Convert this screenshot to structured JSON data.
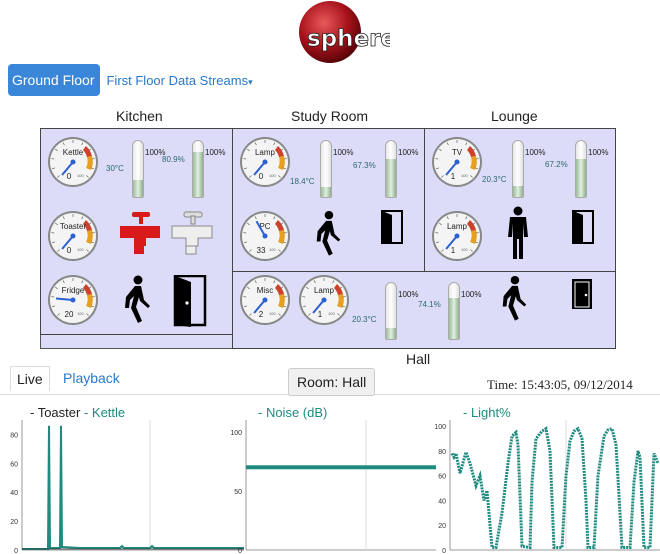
{
  "brand": {
    "logo_text": "sphere"
  },
  "nav": {
    "ground_floor": "Ground Floor",
    "first_floor": "First Floor Data Streams",
    "caret": "▾"
  },
  "rooms": {
    "kitchen": "Kitchen",
    "study_room": "Study Room",
    "lounge": "Lounge",
    "hall": "Hall"
  },
  "kitchen": {
    "gauges": [
      {
        "label": "Kettle",
        "value": "0"
      },
      {
        "label": "Toaster",
        "value": "0"
      },
      {
        "label": "Fridge",
        "value": "20"
      }
    ],
    "temp": "30°C",
    "humidity": "80.9%",
    "therm1_max": "100%",
    "therm2_max": "100%",
    "temp_level": 0.3,
    "humidity_level": 0.809
  },
  "study": {
    "gauges": [
      {
        "label": "Lamp",
        "value": "0"
      },
      {
        "label": "PC",
        "value": "33"
      }
    ],
    "temp": "18.4°C",
    "humidity": "67.3%",
    "therm1_max": "100%",
    "therm2_max": "100%",
    "temp_level": 0.184,
    "humidity_level": 0.673
  },
  "lounge": {
    "gauges": [
      {
        "label": "TV",
        "value": "1"
      },
      {
        "label": "Lamp",
        "value": "1"
      }
    ],
    "temp": "20.3°C",
    "humidity": "67.2%",
    "therm1_max": "100%",
    "therm2_max": "100%",
    "temp_level": 0.203,
    "humidity_level": 0.672
  },
  "hall": {
    "gauges": [
      {
        "label": "Misc",
        "value": "2"
      },
      {
        "label": "Lamp",
        "value": "1"
      }
    ],
    "temp": "20.3°C",
    "humidity": "74.1%",
    "therm1_max": "100%",
    "therm2_max": "100%",
    "temp_level": 0.203,
    "humidity_level": 0.741
  },
  "gauge_scale_max": "100",
  "tabs": {
    "live": "Live",
    "playback": "Playback"
  },
  "room_select": "Room: Hall",
  "time": "Time: 15:43:05, 09/12/2014",
  "chart_titles": {
    "c1_prefix1": "- Toaster",
    "c1_prefix2": "- Kettle",
    "c2": "- Noise (dB)",
    "c3": "- Light%"
  },
  "chart_data": [
    {
      "type": "line",
      "series": [
        {
          "name": "Toaster"
        },
        {
          "name": "Kettle"
        }
      ],
      "y_ticks": [
        "80",
        "60",
        "40",
        "20",
        "0"
      ],
      "ylim": [
        0,
        90
      ],
      "grid": true
    },
    {
      "type": "scatter",
      "series": [
        {
          "name": "Noise (dB)"
        }
      ],
      "y_ticks": [
        "100",
        "50",
        "0"
      ],
      "ylim": [
        0,
        110
      ],
      "values_level": 70,
      "grid": true
    },
    {
      "type": "scatter",
      "series": [
        {
          "name": "Light%"
        }
      ],
      "y_ticks": [
        "100",
        "80",
        "60",
        "40",
        "20",
        "0"
      ],
      "ylim": [
        0,
        105
      ],
      "grid": true
    }
  ],
  "colors": {
    "accent": "#3a87d9",
    "teal": "#1f8a7e",
    "plan_bg": "#dcdcf8",
    "logo_red": "#b3121c"
  }
}
